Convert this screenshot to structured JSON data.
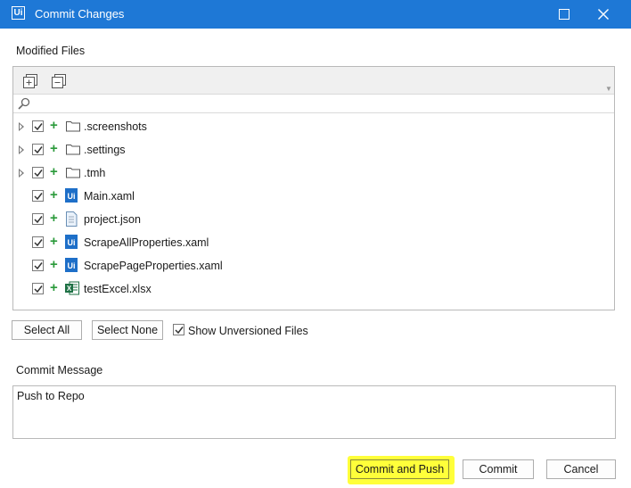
{
  "window": {
    "title": "Commit Changes",
    "logo_text": "Ui"
  },
  "modified_files": {
    "label": "Modified Files",
    "search_placeholder": "",
    "items": [
      {
        "name": ".screenshots",
        "type": "folder",
        "checked": true,
        "expandable": true
      },
      {
        "name": ".settings",
        "type": "folder",
        "checked": true,
        "expandable": true
      },
      {
        "name": ".tmh",
        "type": "folder",
        "checked": true,
        "expandable": true
      },
      {
        "name": "Main.xaml",
        "type": "xaml",
        "checked": true,
        "expandable": false
      },
      {
        "name": "project.json",
        "type": "json",
        "checked": true,
        "expandable": false
      },
      {
        "name": "ScrapeAllProperties.xaml",
        "type": "xaml",
        "checked": true,
        "expandable": false
      },
      {
        "name": "ScrapePageProperties.xaml",
        "type": "xaml",
        "checked": true,
        "expandable": false
      },
      {
        "name": "testExcel.xlsx",
        "type": "excel",
        "checked": true,
        "expandable": false
      }
    ]
  },
  "selection": {
    "select_all_label": "Select All",
    "select_none_label": "Select None",
    "show_unversioned_label": "Show Unversioned Files",
    "show_unversioned_checked": true
  },
  "commit_message": {
    "label": "Commit Message",
    "value": "Push to Repo"
  },
  "actions": {
    "commit_and_push_label": "Commit and Push",
    "commit_label": "Commit",
    "cancel_label": "Cancel"
  },
  "colors": {
    "titlebar": "#1e78d6",
    "highlight": "#ffff3a",
    "added_plus": "#2a9a3a",
    "uipath_blue": "#1e6fc8",
    "excel_green": "#1e7145"
  }
}
